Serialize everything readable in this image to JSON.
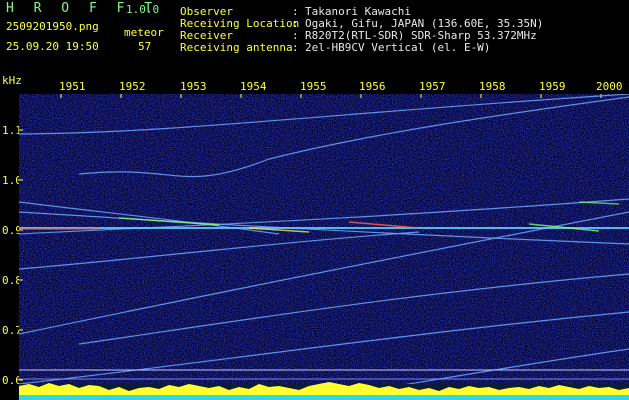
{
  "app": {
    "name": "H R O F F T",
    "version": "1.0.0"
  },
  "file": {
    "name": "2509201950.png",
    "datetime": "25.09.20 19:50"
  },
  "counter": {
    "label": "meteor",
    "value": "57"
  },
  "info": [
    {
      "label": "Observer",
      "value": "Takanori Kawachi"
    },
    {
      "label": "Receiving Location",
      "value": "Ogaki, Gifu, JAPAN (136.60E, 35.35N)"
    },
    {
      "label": "Receiver",
      "value": "R820T2(RTL-SDR) SDR-Sharp 53.372MHz"
    },
    {
      "label": "Receiving antenna",
      "value": "2el-HB9CV Vertical (el. E-W)"
    }
  ],
  "yunit": "kHz",
  "xticks": [
    "1951",
    "1952",
    "1953",
    "1954",
    "1955",
    "1956",
    "1957",
    "1958",
    "1959",
    "2000"
  ],
  "yticks": [
    "1.1",
    "1.0",
    "0.9",
    "0.8",
    "0.7",
    "0.6"
  ],
  "colors": {
    "label": "#ffff40",
    "text": "#e8e8e8",
    "app": "#7cfc7c",
    "bg": "#000000"
  }
}
